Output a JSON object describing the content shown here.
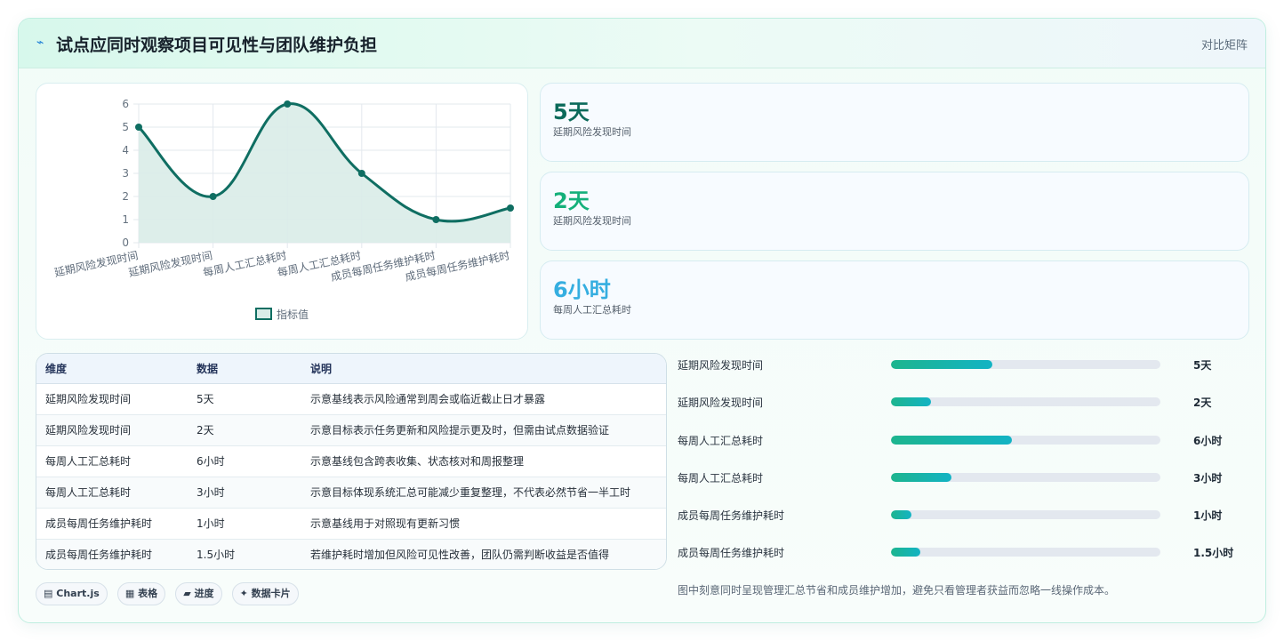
{
  "header": {
    "icon": "lightning-icon",
    "title": "试点应同时观察项目可见性与团队维护负担",
    "action_label": "对比矩阵"
  },
  "chart_data": {
    "type": "line",
    "categories": [
      "延期风险发现时间",
      "延期风险发现时间",
      "每周人工汇总耗时",
      "每周人工汇总耗时",
      "成员每周任务维护耗时",
      "成员每周任务维护耗时"
    ],
    "series": [
      {
        "name": "指标值",
        "values": [
          5,
          2,
          6,
          3,
          1,
          1.5
        ]
      }
    ],
    "yticks": [
      "0",
      "1",
      "2",
      "3",
      "4",
      "5",
      "6"
    ],
    "ylim": [
      0,
      6
    ],
    "grid": true,
    "legend": "bottom",
    "line_color": "#0f6e62",
    "fill_color": "#d9ece8"
  },
  "kpis": [
    {
      "value": "5天",
      "label": "延期风险发现时间",
      "color": "#0b6a5a"
    },
    {
      "value": "2天",
      "label": "延期风险发现时间",
      "color": "#14b07a"
    },
    {
      "value": "6小时",
      "label": "每周人工汇总耗时",
      "color": "#35aee0"
    }
  ],
  "table": {
    "headers": [
      "维度",
      "数据",
      "说明"
    ],
    "rows": [
      [
        "延期风险发现时间",
        "5天",
        "示意基线表示风险通常到周会或临近截止日才暴露"
      ],
      [
        "延期风险发现时间",
        "2天",
        "示意目标表示任务更新和风险提示更及时，但需由试点数据验证"
      ],
      [
        "每周人工汇总耗时",
        "6小时",
        "示意基线包含跨表收集、状态核对和周报整理"
      ],
      [
        "每周人工汇总耗时",
        "3小时",
        "示意目标体现系统汇总可能减少重复整理，不代表必然节省一半工时"
      ],
      [
        "成员每周任务维护耗时",
        "1小时",
        "示意基线用于对照现有更新习惯"
      ],
      [
        "成员每周任务维护耗时",
        "1.5小时",
        "若维护耗时增加但风险可见性改善，团队仍需判断收益是否值得"
      ]
    ]
  },
  "bars": [
    {
      "label": "延期风险发现时间",
      "value": "5天",
      "fraction": 0.375
    },
    {
      "label": "延期风险发现时间",
      "value": "2天",
      "fraction": 0.15
    },
    {
      "label": "每周人工汇总耗时",
      "value": "6小时",
      "fraction": 0.45
    },
    {
      "label": "每周人工汇总耗时",
      "value": "3小时",
      "fraction": 0.225
    },
    {
      "label": "成员每周任务维护耗时",
      "value": "1小时",
      "fraction": 0.075
    },
    {
      "label": "成员每周任务维护耗时",
      "value": "1.5小时",
      "fraction": 0.11
    }
  ],
  "note": "图中刻意同时呈现管理汇总节省和成员维护增加，避免只看管理者获益而忽略一线操作成本。",
  "chips": [
    {
      "icon": "chart-icon",
      "glyph": "▤",
      "label": "Chart.js"
    },
    {
      "icon": "table-icon",
      "glyph": "▦",
      "label": "表格"
    },
    {
      "icon": "progress-icon",
      "glyph": "▰",
      "label": "进度"
    },
    {
      "icon": "card-icon",
      "glyph": "✦",
      "label": "数据卡片"
    }
  ]
}
